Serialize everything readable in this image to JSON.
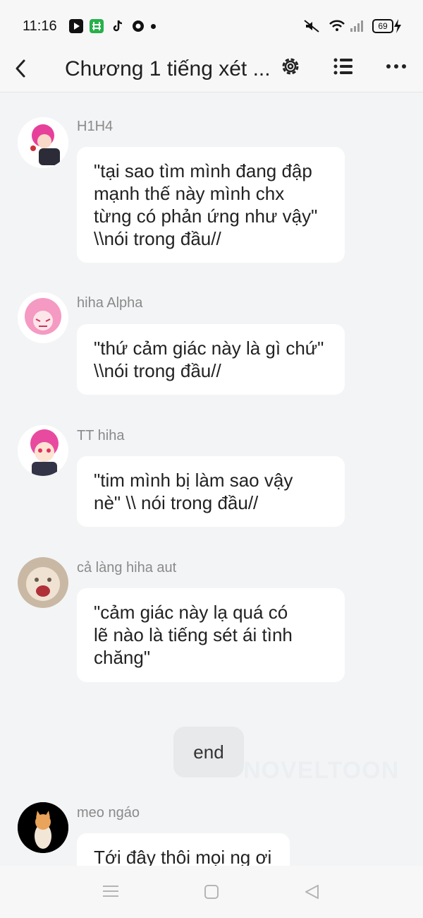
{
  "status_bar": {
    "time": "11:16",
    "battery": "69"
  },
  "header": {
    "title": "Chương 1 tiếng xét ..."
  },
  "messages": [
    {
      "name": "H1H4",
      "text": "\"tại sao tìm mình đang đập\nmạnh thế này mình chx\ntừng có phản ứng như vậy\"\n\\\\nói trong đầu//"
    },
    {
      "name": "hiha Alpha",
      "text": "\"thứ cảm giác này là gì chứ\"\n\\\\nói trong đầu//"
    },
    {
      "name": "TT hiha",
      "text": "\"tim mình bị làm sao vậy\nnè\" \\\\ nói trong đầu//"
    },
    {
      "name": "cả làng hiha aut",
      "text": "\"cảm giác này lạ quá có\nlẽ nào là tiếng sét ái tình\nchăng\""
    },
    {
      "name": "meo ngáo",
      "text": "Tới đây thôi mọi ng ơi"
    }
  ],
  "end_label": "end",
  "watermark": "NOVELTOON",
  "icons": {
    "back": "chevron-left-icon",
    "settings": "gear-icon",
    "list": "list-icon",
    "more": "more-dots-icon"
  }
}
